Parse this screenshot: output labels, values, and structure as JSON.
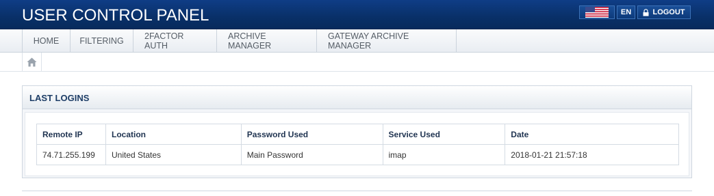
{
  "header": {
    "title": "USER CONTROL PANEL",
    "flag_icon": "us-flag-icon",
    "language": "EN",
    "logout_label": "LOGOUT",
    "logout_icon": "lock-icon"
  },
  "nav": {
    "tabs": [
      {
        "label": "HOME"
      },
      {
        "label": "FILTERING"
      },
      {
        "label": "2FACTOR AUTH"
      },
      {
        "label": "ARCHIVE MANAGER"
      },
      {
        "label": "GATEWAY ARCHIVE MANAGER"
      }
    ]
  },
  "breadcrumb": {
    "home_icon": "home-icon"
  },
  "panel": {
    "title": "LAST LOGINS",
    "columns": [
      "Remote IP",
      "Location",
      "Password Used",
      "Service Used",
      "Date"
    ],
    "rows": [
      [
        "74.71.255.199",
        "United States",
        "Main Password",
        "imap",
        "2018-01-21 21:57:18"
      ]
    ]
  },
  "colors": {
    "header_bg": "#093068",
    "accent": "#1d3d66"
  }
}
